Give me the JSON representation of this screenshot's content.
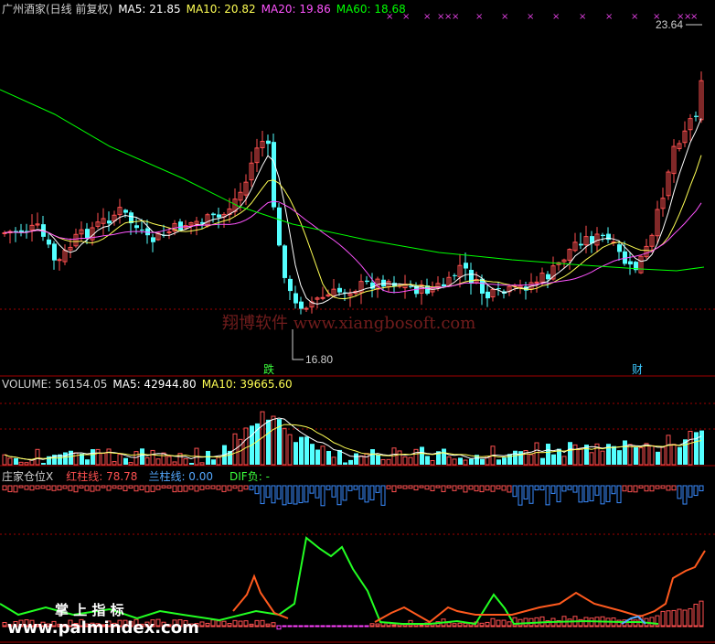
{
  "header_price": {
    "stock": "广州酒家(日线 前复权)",
    "ma5": "MA5: 21.85",
    "ma10": "MA10: 20.82",
    "ma20": "MA20: 19.86",
    "ma60": "MA60: 18.68"
  },
  "header_volume": {
    "volume": "VOLUME: 56154.05",
    "ma5": "MA5: 42944.80",
    "ma10": "MA10: 39665.60"
  },
  "header_indicator": {
    "name": "庄家仓位X",
    "red": "红柱线: 78.78",
    "blue": "兰柱线: 0.00",
    "dif": "DIF负: -"
  },
  "annotations": {
    "high": "23.64",
    "low": "16.80",
    "mark_left": "跌",
    "mark_right": "财"
  },
  "watermarks": {
    "center": "翔博软件 www.xiangbosoft.com",
    "brand": "掌 上 指 标",
    "url": "www.palmindex.com"
  },
  "colors": {
    "up": "#ff5050",
    "down": "#54ffff",
    "ma5": "#ffffff",
    "ma10": "#ffff54",
    "ma20": "#ff54ff",
    "ma60": "#00ff00",
    "green_line": "#22ff22",
    "orange_line": "#ff5a1e",
    "grid": "#a00000"
  },
  "chart_data": [
    {
      "type": "candlestick",
      "price_range": [
        16.8,
        23.64
      ],
      "series": [
        {
          "name": "MA5",
          "values": [
            21.85
          ]
        },
        {
          "name": "MA10",
          "values": [
            20.82
          ]
        },
        {
          "name": "MA20",
          "values": [
            19.86
          ]
        },
        {
          "name": "MA60",
          "values": [
            18.68
          ]
        }
      ]
    },
    {
      "type": "bar",
      "series": [
        {
          "name": "VOLUME",
          "values": [
            56154.05
          ]
        },
        {
          "name": "MA5",
          "values": [
            42944.8
          ]
        },
        {
          "name": "MA10",
          "values": [
            39665.6
          ]
        }
      ]
    },
    {
      "type": "bar",
      "series": [
        {
          "name": "红柱线",
          "values": [
            78.78
          ]
        },
        {
          "name": "兰柱线",
          "values": [
            0.0
          ]
        }
      ]
    }
  ]
}
